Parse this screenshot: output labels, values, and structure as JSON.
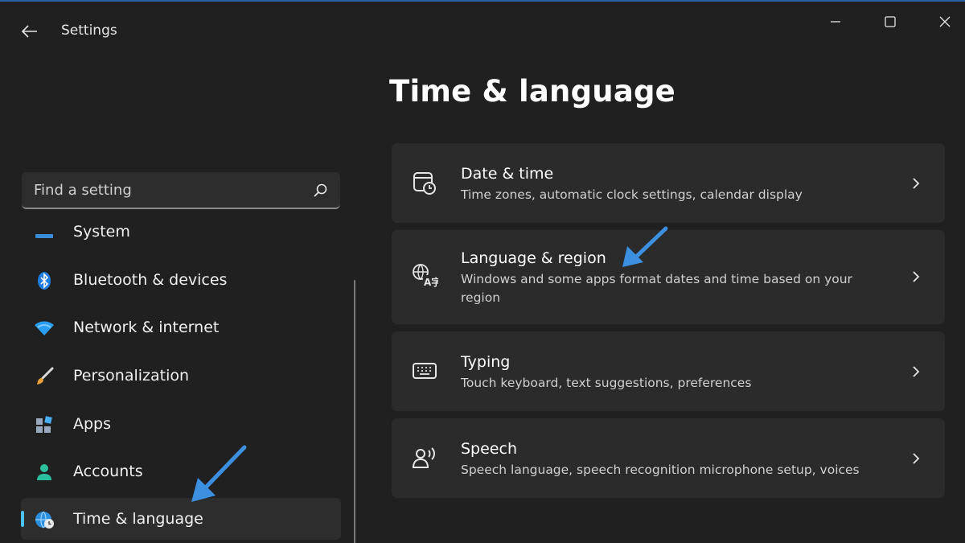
{
  "app": {
    "title": "Settings"
  },
  "search": {
    "placeholder": "Find a setting"
  },
  "sidebar": {
    "items": [
      {
        "label": "System"
      },
      {
        "label": "Bluetooth & devices"
      },
      {
        "label": "Network & internet"
      },
      {
        "label": "Personalization"
      },
      {
        "label": "Apps"
      },
      {
        "label": "Accounts"
      },
      {
        "label": "Time & language",
        "selected": true
      }
    ]
  },
  "main": {
    "title": "Time & language",
    "cards": [
      {
        "title": "Date & time",
        "subtitle": "Time zones, automatic clock settings, calendar display"
      },
      {
        "title": "Language & region",
        "subtitle": "Windows and some apps format dates and time based on your region"
      },
      {
        "title": "Typing",
        "subtitle": "Touch keyboard, text suggestions, preferences"
      },
      {
        "title": "Speech",
        "subtitle": "Speech language, speech recognition microphone setup, voices"
      }
    ]
  },
  "colors": {
    "accent": "#4cc2ff",
    "annotation_arrow": "#3d8fe0",
    "background": "#202020",
    "card": "#2b2b2b"
  }
}
